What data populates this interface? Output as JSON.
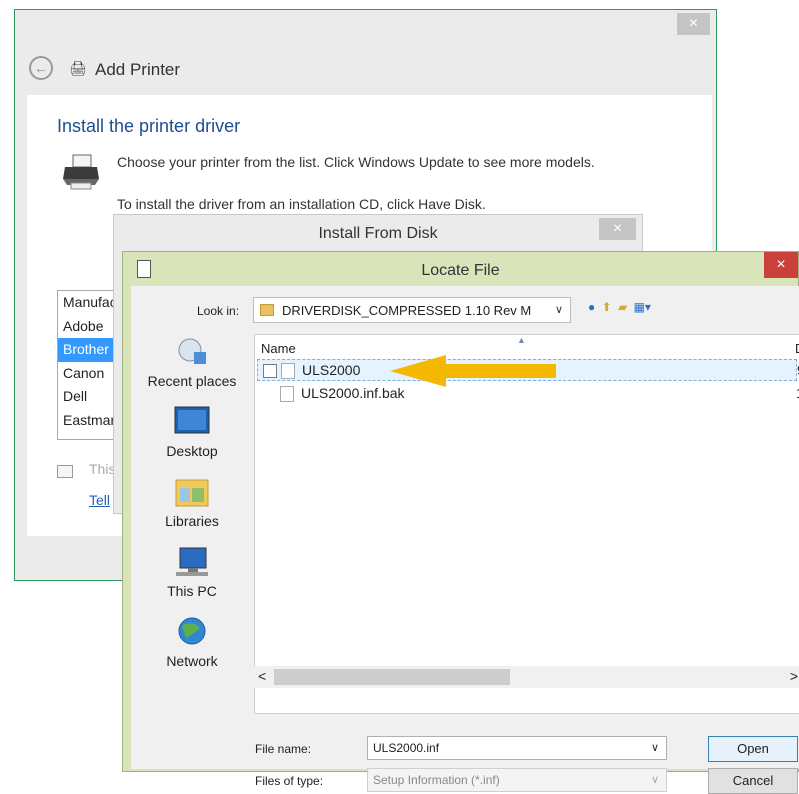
{
  "add_printer": {
    "title": "Add Printer",
    "close": "×",
    "back": "←",
    "heading": "Install the printer driver",
    "line1": "Choose your printer from the list. Click Windows Update to see more models.",
    "line2": "To install the driver from an installation CD, click Have Disk.",
    "manufacturers": [
      "Manufac",
      "Adobe",
      "Brother",
      "Canon",
      "Dell",
      "Eastmar"
    ],
    "selected_manufacturer": "Brother",
    "signed_text": "This",
    "tell_link": "Tell"
  },
  "install_from_disk": {
    "title": "Install From Disk",
    "close": "×"
  },
  "locate_file": {
    "title": "Locate File",
    "close": "×",
    "look_in_label": "Look in:",
    "look_in_value": "DRIVERDISK_COMPRESSED 1.10 Rev M",
    "places": [
      "Recent places",
      "Desktop",
      "Libraries",
      "This PC",
      "Network"
    ],
    "columns": {
      "name": "Name",
      "second": "D"
    },
    "files": [
      {
        "name": "ULS2000",
        "extra": "9",
        "selected": true
      },
      {
        "name": "ULS2000.inf.bak",
        "extra": "1",
        "selected": false
      }
    ],
    "file_name_label": "File name:",
    "file_name_value": "ULS2000.inf",
    "files_of_type_label": "Files of type:",
    "files_of_type_value": "Setup Information (*.inf)",
    "open_label": "Open",
    "cancel_label": "Cancel",
    "scroll_left": "<",
    "scroll_right": ">",
    "dropdown_glyph": "∨"
  },
  "arrow_color": "#f5b800"
}
